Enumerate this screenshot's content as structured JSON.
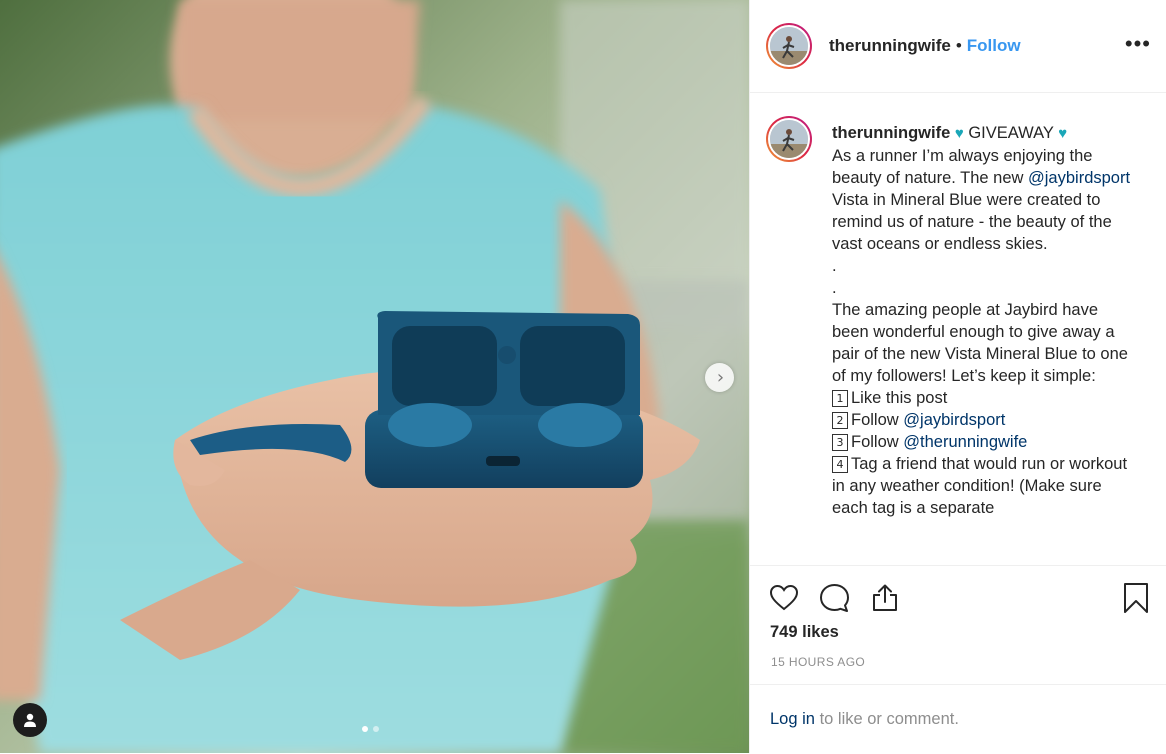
{
  "post": {
    "username": "therunningwife",
    "follow_label": "Follow",
    "separator": "•",
    "more_label": "•••"
  },
  "caption": {
    "username": "therunningwife",
    "heading": "GIVEAWAY",
    "heart_glyph": "♥",
    "p1_a": "As a runner I’m always enjoying the beauty of nature. The new",
    "mention1": "@jaybirdsport",
    "p1_b": "Vista in Mineral Blue were created to remind us of nature - the beauty of the vast oceans or endless skies.",
    "dot1": ".",
    "dot2": ".",
    "p2": "The amazing people at Jaybird have been wonderful enough to give away a pair of the new Vista Mineral Blue to one of my followers! Let’s keep it simple:",
    "steps": [
      {
        "num": "1",
        "text": "Like this post",
        "mention": ""
      },
      {
        "num": "2",
        "text": "Follow",
        "mention": "@jaybirdsport"
      },
      {
        "num": "3",
        "text": "Follow",
        "mention": "@therunningwife"
      },
      {
        "num": "4",
        "text": "Tag a friend that would run or workout in any weather condition! (Make sure each tag is a separate",
        "mention": ""
      }
    ]
  },
  "stats": {
    "likes": "749 likes",
    "time": "15 HOURS AGO"
  },
  "login": {
    "link": "Log in",
    "rest": "to like or comment."
  },
  "carousel": {
    "next_glyph": "›",
    "total": 2,
    "current": 1
  },
  "colors": {
    "follow": "#3897f0",
    "link": "#003569",
    "heart": "#1aa7b8",
    "meta": "#8e8e8e"
  }
}
